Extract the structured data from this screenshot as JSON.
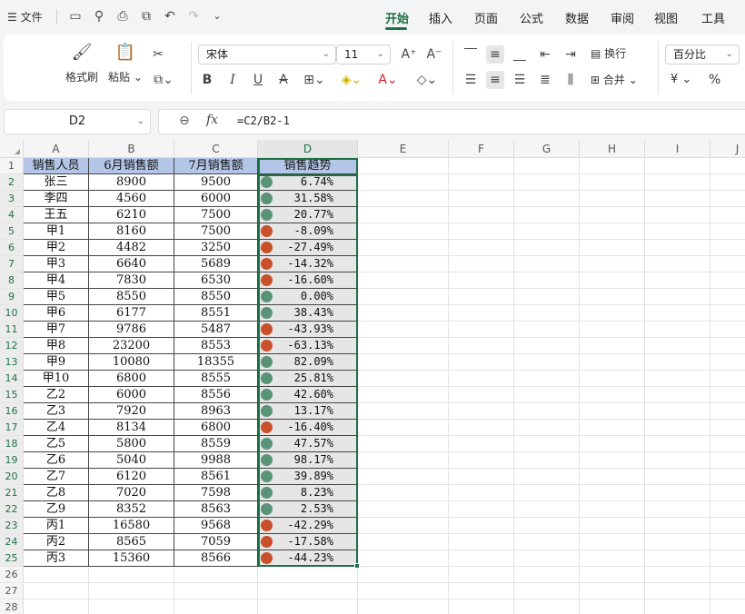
{
  "menu": {
    "file_label": "文件",
    "tabs": [
      "开始",
      "插入",
      "页面",
      "公式",
      "数据",
      "审阅",
      "视图",
      "工具"
    ],
    "active_tab": "开始"
  },
  "ribbon": {
    "format_painter": "格式刷",
    "paste": "粘贴",
    "font_name": "宋体",
    "font_size": "11",
    "wrap_text": "换行",
    "merge": "合并",
    "number_format": "百分比",
    "currency_symbol": "¥",
    "percent_symbol": "%"
  },
  "formula_bar": {
    "name_box": "D2",
    "fx_label": "fx",
    "formula": "=C2/B2-1"
  },
  "sheet": {
    "columns": [
      "A",
      "B",
      "C",
      "D",
      "E",
      "F",
      "G",
      "H",
      "I",
      "J"
    ],
    "selected_column": "D",
    "header_row": [
      "销售人员",
      "6月销售额",
      "7月销售额",
      "销售趋势"
    ],
    "rows": [
      {
        "name": "张三",
        "jun": "8900",
        "jul": "9500",
        "trend": "6.74%",
        "status": "up"
      },
      {
        "name": "李四",
        "jun": "4560",
        "jul": "6000",
        "trend": "31.58%",
        "status": "up"
      },
      {
        "name": "王五",
        "jun": "6210",
        "jul": "7500",
        "trend": "20.77%",
        "status": "up"
      },
      {
        "name": "甲1",
        "jun": "8160",
        "jul": "7500",
        "trend": "-8.09%",
        "status": "down"
      },
      {
        "name": "甲2",
        "jun": "4482",
        "jul": "3250",
        "trend": "-27.49%",
        "status": "down"
      },
      {
        "name": "甲3",
        "jun": "6640",
        "jul": "5689",
        "trend": "-14.32%",
        "status": "down"
      },
      {
        "name": "甲4",
        "jun": "7830",
        "jul": "6530",
        "trend": "-16.60%",
        "status": "down"
      },
      {
        "name": "甲5",
        "jun": "8550",
        "jul": "8550",
        "trend": "0.00%",
        "status": "up"
      },
      {
        "name": "甲6",
        "jun": "6177",
        "jul": "8551",
        "trend": "38.43%",
        "status": "up"
      },
      {
        "name": "甲7",
        "jun": "9786",
        "jul": "5487",
        "trend": "-43.93%",
        "status": "down"
      },
      {
        "name": "甲8",
        "jun": "23200",
        "jul": "8553",
        "trend": "-63.13%",
        "status": "down"
      },
      {
        "name": "甲9",
        "jun": "10080",
        "jul": "18355",
        "trend": "82.09%",
        "status": "up"
      },
      {
        "name": "甲10",
        "jun": "6800",
        "jul": "8555",
        "trend": "25.81%",
        "status": "up"
      },
      {
        "name": "乙2",
        "jun": "6000",
        "jul": "8556",
        "trend": "42.60%",
        "status": "up"
      },
      {
        "name": "乙3",
        "jun": "7920",
        "jul": "8963",
        "trend": "13.17%",
        "status": "up"
      },
      {
        "name": "乙4",
        "jun": "8134",
        "jul": "6800",
        "trend": "-16.40%",
        "status": "down"
      },
      {
        "name": "乙5",
        "jun": "5800",
        "jul": "8559",
        "trend": "47.57%",
        "status": "up"
      },
      {
        "name": "乙6",
        "jun": "5040",
        "jul": "9988",
        "trend": "98.17%",
        "status": "up"
      },
      {
        "name": "乙7",
        "jun": "6120",
        "jul": "8561",
        "trend": "39.89%",
        "status": "up"
      },
      {
        "name": "乙8",
        "jun": "7020",
        "jul": "7598",
        "trend": "8.23%",
        "status": "up"
      },
      {
        "name": "乙9",
        "jun": "8352",
        "jul": "8563",
        "trend": "2.53%",
        "status": "up"
      },
      {
        "name": "丙1",
        "jun": "16580",
        "jul": "9568",
        "trend": "-42.29%",
        "status": "down"
      },
      {
        "name": "丙2",
        "jun": "8565",
        "jul": "7059",
        "trend": "-17.58%",
        "status": "down"
      },
      {
        "name": "丙3",
        "jun": "15360",
        "jul": "8566",
        "trend": "-44.23%",
        "status": "down"
      }
    ],
    "row_numbers": [
      "1",
      "2",
      "3",
      "4",
      "5",
      "6",
      "7",
      "8",
      "9",
      "10",
      "11",
      "12",
      "13",
      "14",
      "15",
      "16",
      "17",
      "18",
      "19",
      "20",
      "21",
      "22",
      "23",
      "24",
      "25",
      "26",
      "27",
      "28"
    ]
  },
  "colors": {
    "up": "#5a9478",
    "down": "#c8502a",
    "accent": "#1e7145",
    "header_fill": "#b4c6e7",
    "trend_fill": "#e6e6e6"
  }
}
